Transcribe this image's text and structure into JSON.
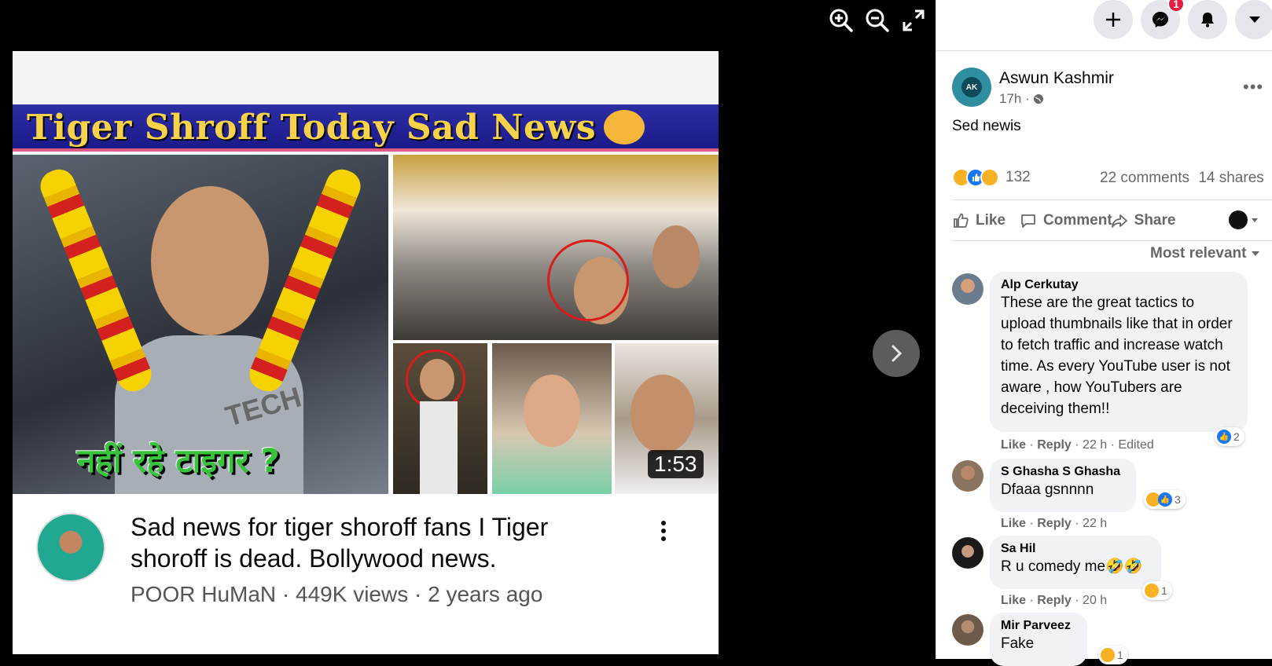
{
  "viewer": {
    "zoom_in_icon": "zoom-in-icon",
    "zoom_out_icon": "zoom-out-icon",
    "fullscreen_icon": "fullscreen-icon",
    "next_icon": "chevron-right-icon"
  },
  "photo": {
    "banner_title": "Tiger Shroff Today Sad News",
    "hindi_caption": "नहीं रहे टाइगर ?",
    "watermark": "TECH",
    "duration": "1:53",
    "video_title": "Sad news for tiger shoroff fans I Tiger shoroff is dead. Bollywood news.",
    "video_meta": "POOR HuMaN · 449K views · 2 years ago"
  },
  "nav": {
    "messenger_badge": "1",
    "icons": [
      "plus-icon",
      "messenger-icon",
      "bell-icon",
      "caret-down-icon"
    ]
  },
  "post": {
    "avatar_text": "AK",
    "author": "Aswun Kashmir",
    "time": "17h ·",
    "text": "Sed newis",
    "reaction_count": "132",
    "comments_count": "22 comments",
    "shares_count": "14 shares",
    "actions": {
      "like": "Like",
      "comment": "Comment",
      "share": "Share"
    },
    "sort_label": "Most relevant"
  },
  "comments": [
    {
      "name": "Alp Cerkutay",
      "text": "These are the great tactics to upload thumbnails like that in order to fetch traffic and increase watch time. As every YouTube user is not aware , how YouTubers are deceiving them!!",
      "like": "Like",
      "reply": "Reply",
      "time": "· 22 h · Edited",
      "reactions": "2"
    },
    {
      "name": "S Ghasha S Ghasha",
      "text": "Dfaaa gsnnnn",
      "like": "Like",
      "reply": "Reply",
      "time": "· 22 h",
      "reactions": "3"
    },
    {
      "name": "Sa Hil",
      "text": "R u comedy me🤣🤣",
      "like": "Like",
      "reply": "Reply",
      "time": "· 20 h",
      "reactions": "1"
    },
    {
      "name": "Mir Parveez",
      "text": "Fake",
      "reactions": "1"
    }
  ],
  "colors": {
    "facebook_blue": "#1877f2",
    "badge_red": "#e41e3f",
    "haha_yellow": "#f7b125",
    "banner_blue": "#1f1f94",
    "banner_text": "#f7d24a"
  }
}
